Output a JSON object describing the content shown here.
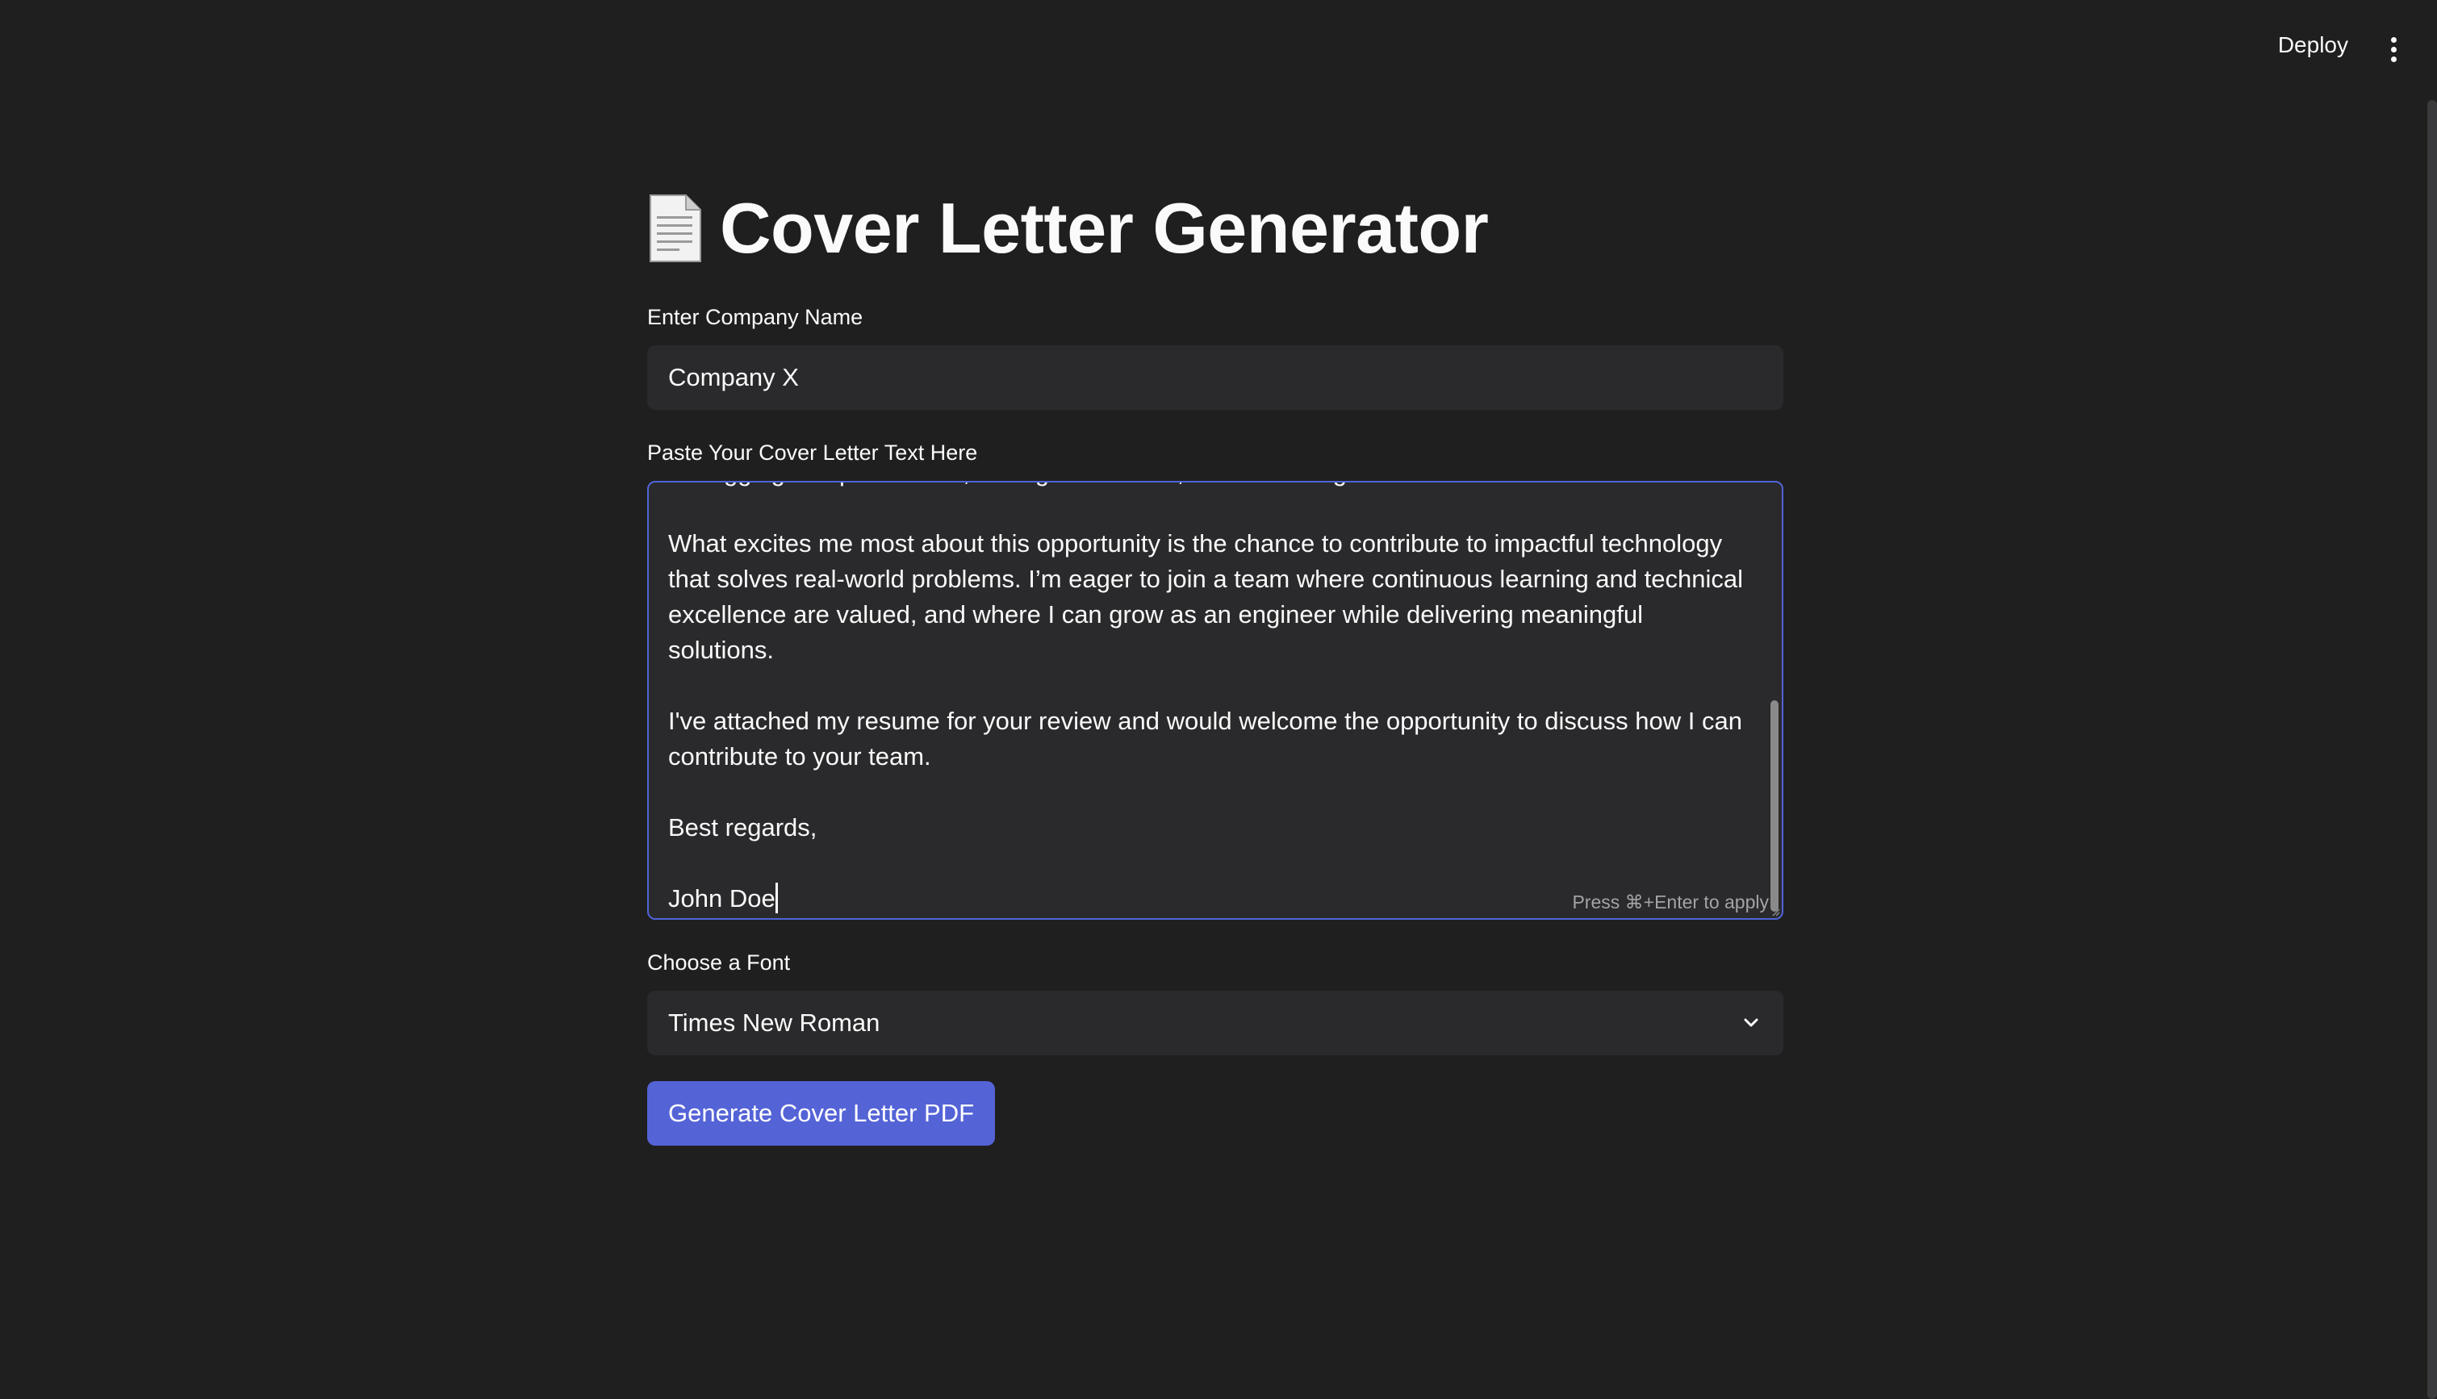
{
  "header": {
    "deploy_label": "Deploy",
    "menu_icon": "kebab-menu-icon"
  },
  "page": {
    "title_icon": "page-facing-up-icon",
    "title": "Cover Letter Generator"
  },
  "company": {
    "label": "Enter Company Name",
    "value": "Company X"
  },
  "letter": {
    "label": "Paste Your Cover Letter Text Here",
    "visible_text": "debugging complex issues, writing clean code, and delivering on time.\n\nWhat excites me most about this opportunity is the chance to contribute to impactful technology\nthat solves real-world problems. I’m eager to join a team where continuous learning and technical\nexcellence are valued, and where I can grow as an engineer while delivering meaningful solutions.\n\nI've attached my resume for your review and would welcome the opportunity to discuss how I can\ncontribute to your team.\n\nBest regards,\n\nJohn Doe",
    "hint": "Press ⌘+Enter to apply"
  },
  "font_select": {
    "label": "Choose a Font",
    "selected": "Times New Roman"
  },
  "generate_button": {
    "label": "Generate Cover Letter PDF"
  },
  "colors": {
    "background": "#1f1f1f",
    "field": "#2a2a2c",
    "focus_border": "#5063d8",
    "primary_button": "#5463d6"
  }
}
